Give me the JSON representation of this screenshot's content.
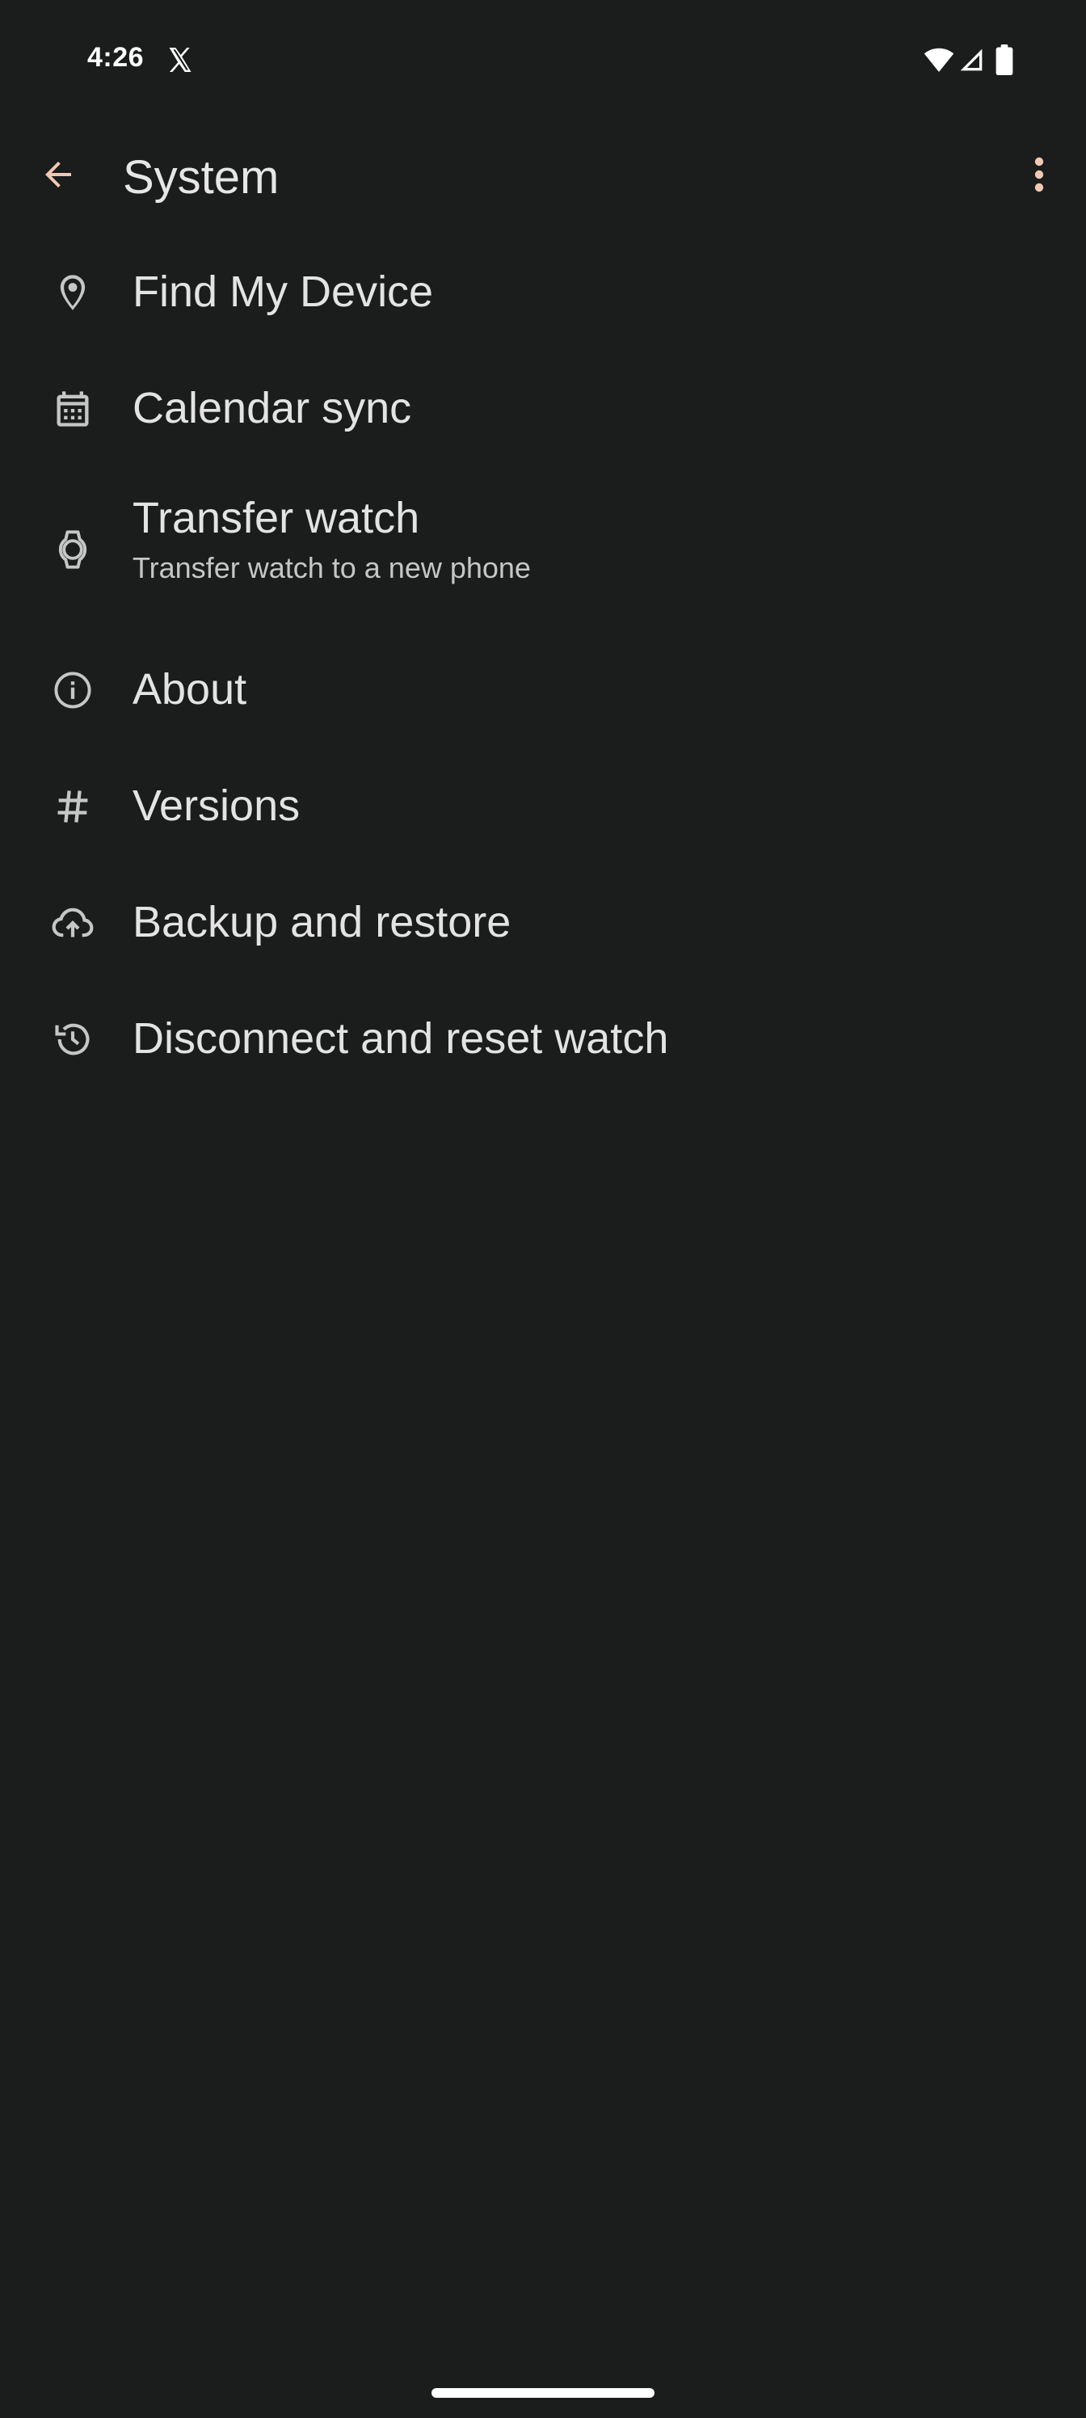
{
  "status_bar": {
    "time": "4:26",
    "notification_icon": "x-icon",
    "icons": [
      "wifi-icon",
      "signal-icon",
      "battery-icon"
    ]
  },
  "app_bar": {
    "title": "System",
    "back_icon": "arrow-back-icon",
    "overflow_icon": "more-vert-icon",
    "accent_color": "#f0c9b4"
  },
  "settings": {
    "items": [
      {
        "icon": "location-pin-icon",
        "label": "Find My Device"
      },
      {
        "icon": "calendar-icon",
        "label": "Calendar sync"
      },
      {
        "icon": "watch-icon",
        "label": "Transfer watch",
        "sublabel": "Transfer watch to a new phone"
      },
      {
        "icon": "info-icon",
        "label": "About"
      },
      {
        "icon": "hash-icon",
        "label": "Versions"
      },
      {
        "icon": "cloud-upload-icon",
        "label": "Backup and restore"
      },
      {
        "icon": "history-icon",
        "label": "Disconnect and reset watch"
      }
    ]
  },
  "colors": {
    "background": "#1b1c1c",
    "text_primary": "#e3e3e3",
    "text_secondary": "#c4c7c5",
    "icon": "#c4c7c5"
  }
}
